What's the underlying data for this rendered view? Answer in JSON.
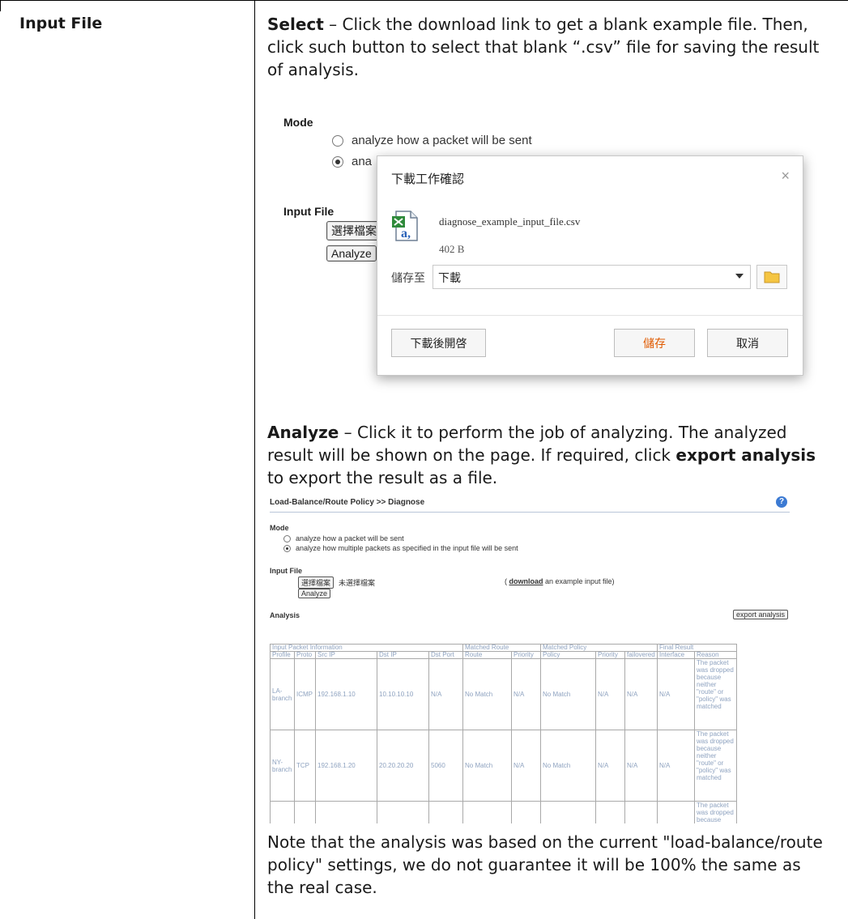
{
  "row": {
    "label": "Input File",
    "select_term": "Select",
    "select_desc": " – Click the download link to get a blank example file. Then, click such button to select that blank “.csv” file for saving the result of analysis.",
    "analyze_term": "Analyze",
    "analyze_desc_1": " – Click it to perform the job of analyzing. The analyzed result will be shown on the page. If required, click ",
    "analyze_export": "export analysis",
    "analyze_desc_2": " to export the result as a file.",
    "note": "Note that the analysis was based on the current \"load-balance/route policy\" settings, we do not guarantee it will be 100% the same as the real case."
  },
  "shot1": {
    "mode_label": "Mode",
    "radio1": "analyze how a packet will be sent",
    "radio2_partial": "ana",
    "input_file_label": "Input File",
    "choose_btn": "選擇檔案",
    "analyze_btn": "Analyze",
    "dialog": {
      "title": "下載工作確認",
      "close": "×",
      "filename": "diagnose_example_input_file.csv",
      "filesize": "402 B",
      "save_to_label": "儲存至",
      "save_to_value": "下載",
      "open_after_btn": "下載後開啓",
      "save_btn": "儲存",
      "cancel_btn": "取消",
      "colors": {
        "save_text": "#e05a00",
        "folder": "#f5c542"
      }
    }
  },
  "shot2": {
    "title": "Load-Balance/Route Policy >> Diagnose",
    "help_icon": "?",
    "mode_label": "Mode",
    "radio1": "analyze how a packet will be sent",
    "radio2": "analyze how multiple packets as specified in the input file will be sent",
    "input_file_label": "Input File",
    "choose_btn": "選擇檔案",
    "no_file": "未選擇檔案",
    "download_prefix": "( ",
    "download_link": "download",
    "download_suffix": " an example input file)",
    "analyze_btn": "Analyze",
    "analysis_label": "Analysis",
    "export_btn": "export analysis",
    "group_headers": [
      "Input Packet Information",
      "Matched Route",
      "Matched Policy",
      "Final Result"
    ],
    "columns": [
      "Profile",
      "Proto",
      "Src IP",
      "Dst IP",
      "Dst Port",
      "Route",
      "Priority",
      "Policy",
      "Priority",
      "failovered",
      "Interface",
      "Reason"
    ],
    "rows": [
      [
        "LA-branch",
        "ICMP",
        "192.168.1.10",
        "10.10.10.10",
        "N/A",
        "No Match",
        "N/A",
        "No Match",
        "N/A",
        "N/A",
        "N/A",
        "The packet was dropped because neither \"route\" or \"policy\" was matched"
      ],
      [
        "NY-branch",
        "TCP",
        "192.168.1.20",
        "20.20.20.20",
        "5060",
        "No Match",
        "N/A",
        "No Match",
        "N/A",
        "N/A",
        "N/A",
        "The packet was dropped because neither \"route\" or \"policy\" was matched"
      ],
      [
        "",
        "",
        "",
        "",
        "",
        "",
        "",
        "",
        "",
        "",
        "",
        "The packet was dropped because"
      ]
    ]
  }
}
